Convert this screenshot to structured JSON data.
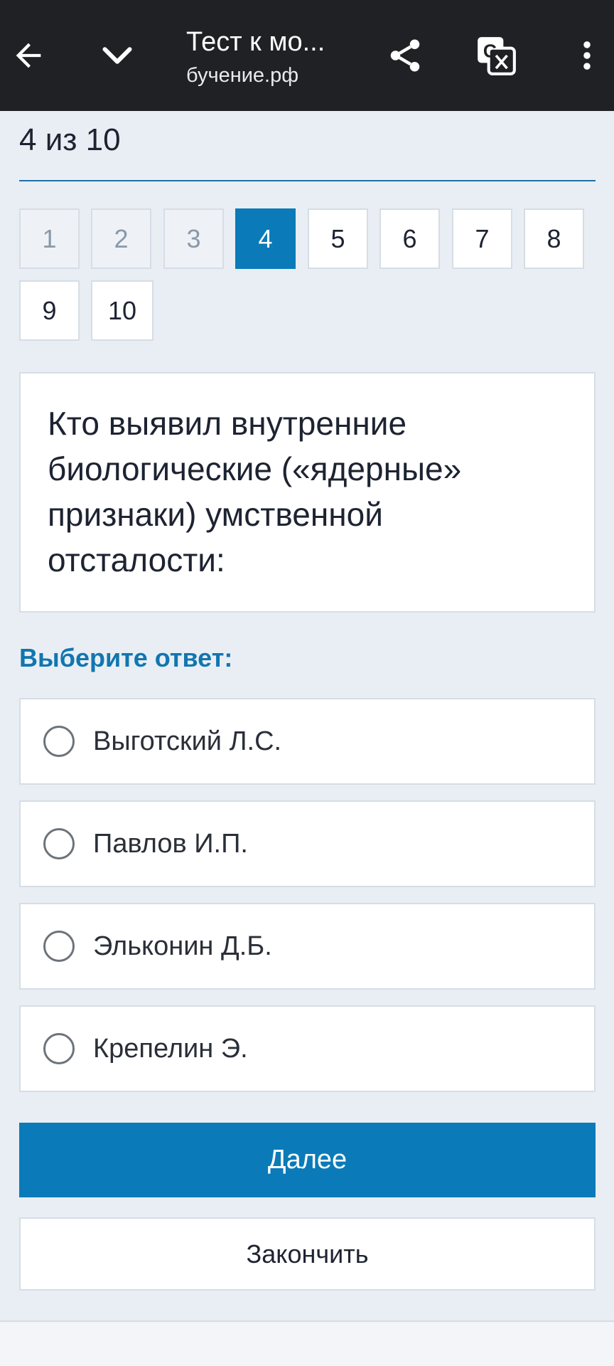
{
  "browser": {
    "title": "Тест к мо...",
    "url": "бучение.рф",
    "icons": {
      "back": "arrow-left-icon",
      "collapse": "chevron-down-icon",
      "share": "share-icon",
      "translate": "translate-icon",
      "menu": "more-vertical-icon"
    }
  },
  "test": {
    "progress_text": "4 из 10",
    "question_numbers": [
      {
        "label": "1",
        "state": "done"
      },
      {
        "label": "2",
        "state": "done"
      },
      {
        "label": "3",
        "state": "done"
      },
      {
        "label": "4",
        "state": "active"
      },
      {
        "label": "5",
        "state": "pending"
      },
      {
        "label": "6",
        "state": "pending"
      },
      {
        "label": "7",
        "state": "pending"
      },
      {
        "label": "8",
        "state": "pending"
      },
      {
        "label": "9",
        "state": "pending"
      },
      {
        "label": "10",
        "state": "pending"
      }
    ],
    "question": "Кто выявил внутренние биологические («ядерные» признаки) умственной отсталости:",
    "choose_label": "Выберите ответ:",
    "options": [
      {
        "label": "Выготский Л.С.",
        "selected": false
      },
      {
        "label": "Павлов И.П.",
        "selected": false
      },
      {
        "label": "Эльконин Д.Б.",
        "selected": false
      },
      {
        "label": "Крепелин Э.",
        "selected": false
      }
    ],
    "next_label": "Далее",
    "finish_label": "Закончить"
  },
  "colors": {
    "accent": "#0a7bb8",
    "topbar": "#202124",
    "background": "#e9eef4"
  }
}
